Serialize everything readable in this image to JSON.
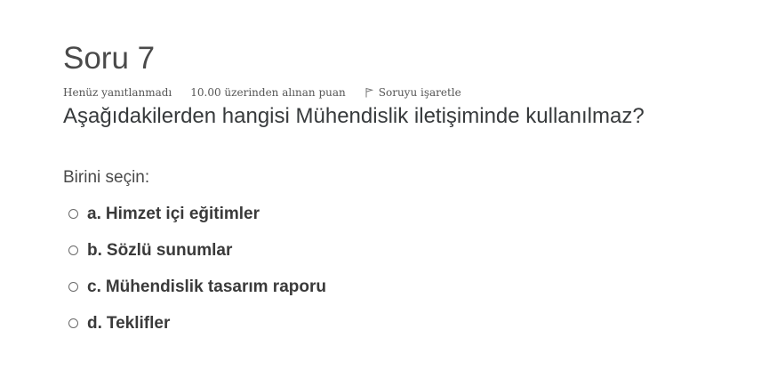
{
  "question": {
    "title": "Soru 7",
    "state": "Henüz yanıtlanmadı",
    "grade": "10.00 üzerinden alınan puan",
    "flag_label": "Soruyu işaretle",
    "flag_icon": "flag-icon",
    "text": "Aşağıdakilerden hangisi Mühendislik iletişiminde kullanılmaz?",
    "prompt": "Birini seçin:",
    "answers": [
      {
        "number": "a.",
        "label": "Himzet içi eğitimler"
      },
      {
        "number": "b.",
        "label": "Sözlü sunumlar"
      },
      {
        "number": "c.",
        "label": "Mühendislik tasarım raporu"
      },
      {
        "number": "d.",
        "label": "Teklifler"
      }
    ]
  }
}
